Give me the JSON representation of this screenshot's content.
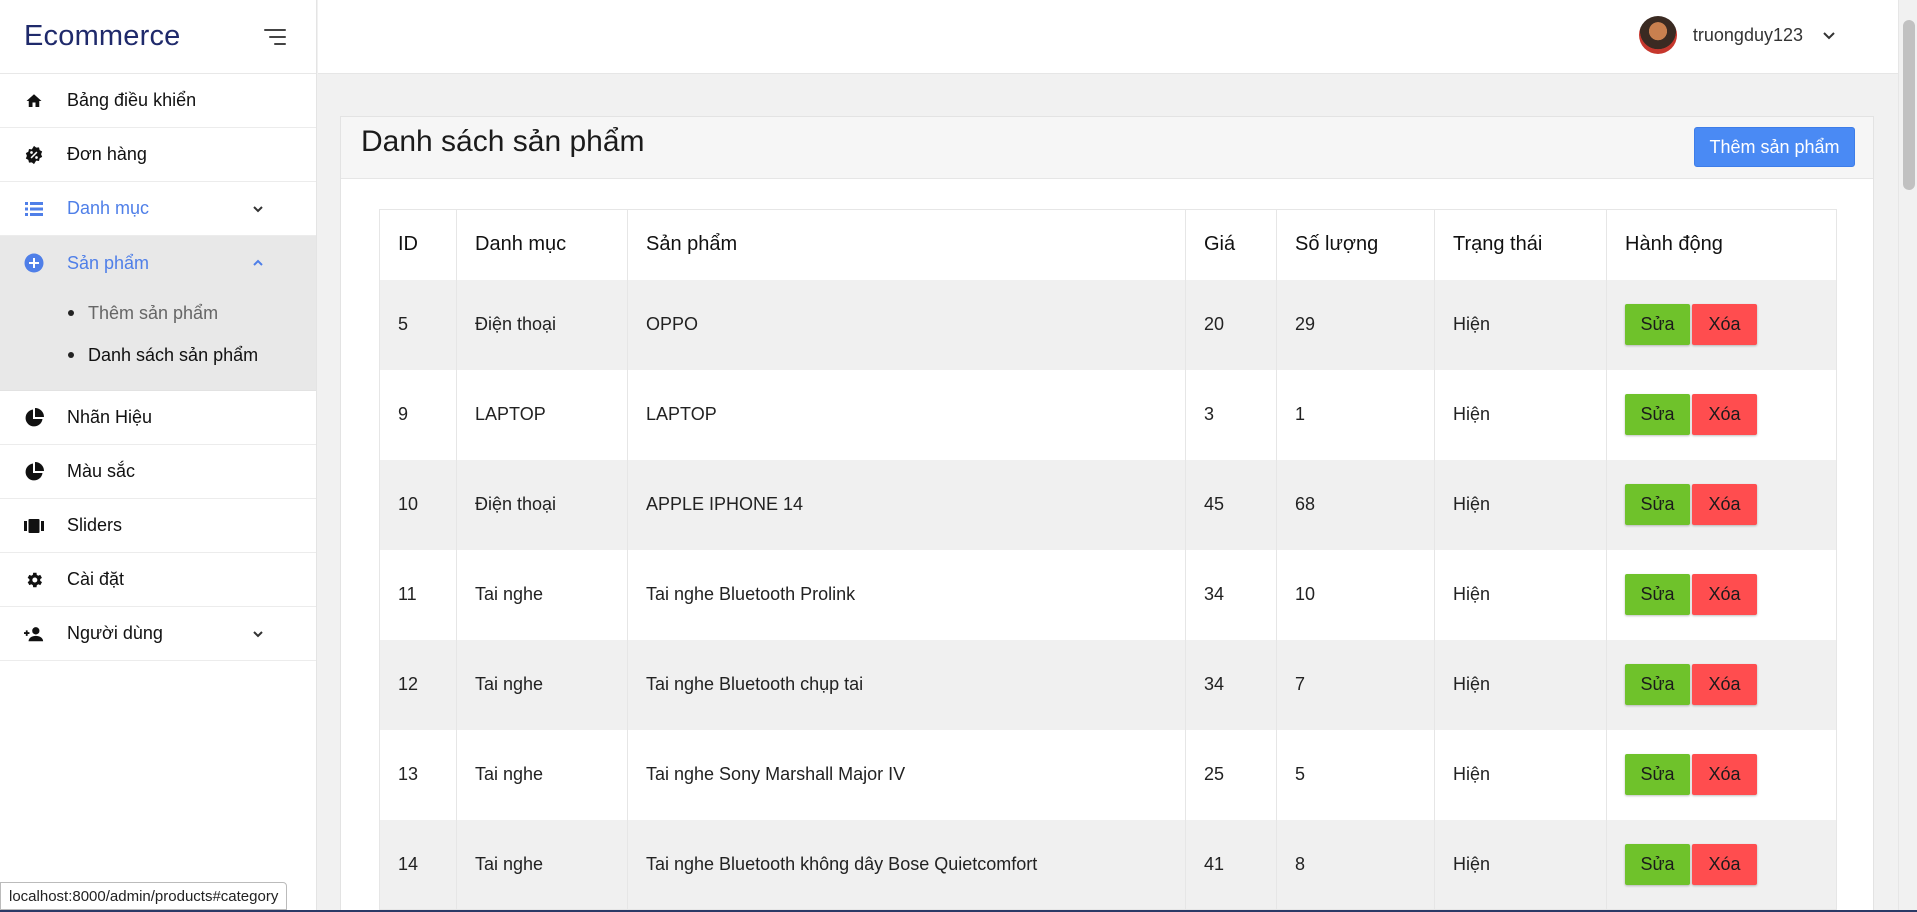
{
  "brand": {
    "title": "Ecommerce"
  },
  "sidebar": {
    "items": [
      {
        "label": "Bảng điều khiển",
        "icon": "home-icon"
      },
      {
        "label": "Đơn hàng",
        "icon": "badge-percent-icon"
      },
      {
        "label": "Danh mục",
        "icon": "list-icon",
        "chevron": "down"
      },
      {
        "label": "Sản phẩm",
        "icon": "plus-circle-icon",
        "chevron": "up"
      },
      {
        "label": "Nhãn Hiệu",
        "icon": "pie-chart-icon"
      },
      {
        "label": "Màu sắc",
        "icon": "pie-chart-icon"
      },
      {
        "label": "Sliders",
        "icon": "carousel-icon"
      },
      {
        "label": "Cài đặt",
        "icon": "gear-icon"
      },
      {
        "label": "Người dùng",
        "icon": "user-add-icon",
        "chevron": "down"
      }
    ],
    "submenu": [
      {
        "label": "Thêm sản phẩm"
      },
      {
        "label": "Danh sách sản phẩm"
      }
    ]
  },
  "header": {
    "username": "truongduy123"
  },
  "page": {
    "title": "Danh sách sản phẩm",
    "add_button": "Thêm sản phẩm"
  },
  "table": {
    "columns": [
      "ID",
      "Danh mục",
      "Sản phẩm",
      "Giá",
      "Số lượng",
      "Trạng thái",
      "Hành động"
    ],
    "rows": [
      {
        "id": "5",
        "category": "Điện thoại",
        "product": "OPPO",
        "price": "20",
        "qty": "29",
        "status": "Hiện"
      },
      {
        "id": "9",
        "category": "LAPTOP",
        "product": "LAPTOP",
        "price": "3",
        "qty": "1",
        "status": "Hiện"
      },
      {
        "id": "10",
        "category": "Điện thoại",
        "product": "APPLE IPHONE 14",
        "price": "45",
        "qty": "68",
        "status": "Hiện"
      },
      {
        "id": "11",
        "category": "Tai nghe",
        "product": "Tai nghe Bluetooth Prolink",
        "price": "34",
        "qty": "10",
        "status": "Hiện"
      },
      {
        "id": "12",
        "category": "Tai nghe",
        "product": "Tai nghe Bluetooth chụp tai",
        "price": "34",
        "qty": "7",
        "status": "Hiện"
      },
      {
        "id": "13",
        "category": "Tai nghe",
        "product": "Tai nghe Sony Marshall Major IV",
        "price": "25",
        "qty": "5",
        "status": "Hiện"
      },
      {
        "id": "14",
        "category": "Tai nghe",
        "product": "Tai nghe Bluetooth không dây Bose Quietcomfort",
        "price": "41",
        "qty": "8",
        "status": "Hiện"
      }
    ],
    "edit_label": "Sửa",
    "delete_label": "Xóa"
  },
  "statusbar": {
    "url": "localhost:8000/admin/products#category"
  },
  "colors": {
    "accent": "#4a8af4",
    "edit": "#6fc22b",
    "delete": "#ff4d4f",
    "active_menu": "#4f7fe8"
  }
}
